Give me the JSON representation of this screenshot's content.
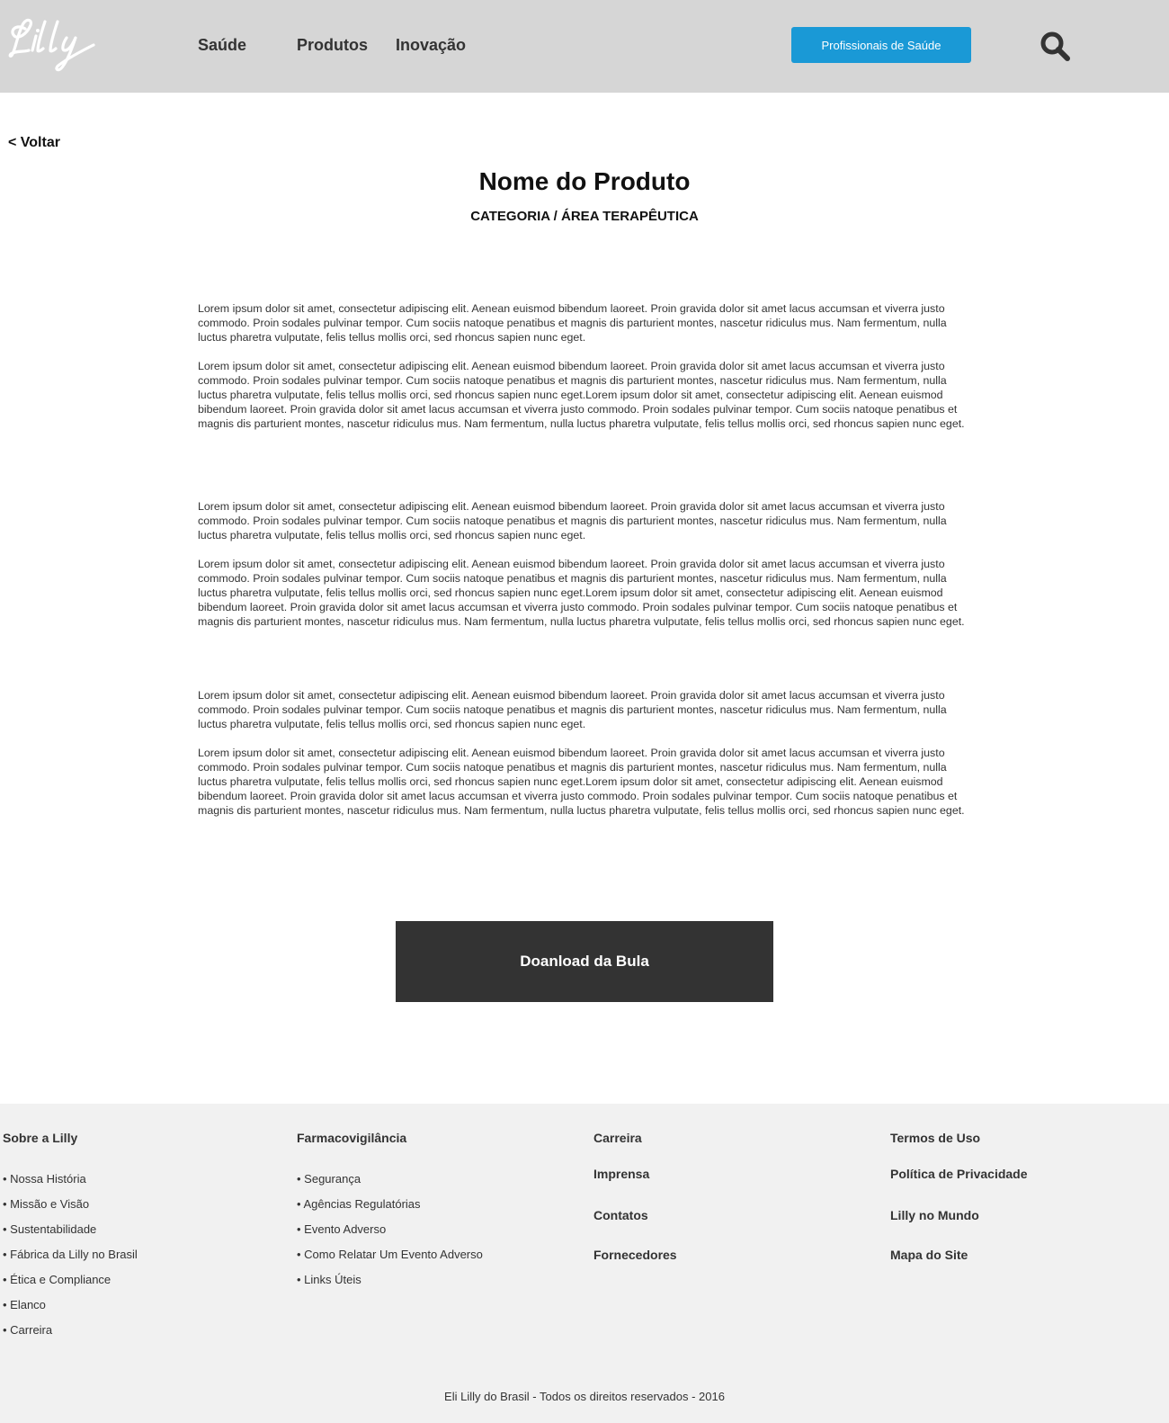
{
  "header": {
    "logo_text": "Lilly",
    "nav": [
      "Saúde",
      "Produtos",
      "Inovação"
    ],
    "cta_label": "Profissionais de Saúde",
    "search_icon": "search-icon"
  },
  "main": {
    "back_label": "< Voltar",
    "title": "Nome do Produto",
    "category": "CATEGORIA / ÁREA TERAPÊUTICA",
    "blocks": [
      {
        "p1": "Lorem ipsum dolor sit amet, consectetur adipiscing elit. Aenean euismod bibendum laoreet. Proin gravida dolor sit amet lacus accumsan et viverra justo commodo. Proin sodales pulvinar tempor. Cum sociis natoque penatibus et magnis dis parturient montes, nascetur ridiculus mus. Nam fermentum, nulla luctus pharetra vulputate, felis tellus mollis orci, sed rhoncus sapien nunc eget.",
        "p2": "Lorem ipsum dolor sit amet, consectetur adipiscing elit. Aenean euismod bibendum laoreet. Proin gravida dolor sit amet lacus accumsan et viverra justo commodo. Proin sodales pulvinar tempor. Cum sociis natoque penatibus et magnis dis parturient montes, nascetur ridiculus mus. Nam fermentum, nulla luctus pharetra vulputate, felis tellus mollis orci, sed rhoncus sapien nunc eget.Lorem ipsum dolor sit amet, consectetur adipiscing elit. Aenean euismod bibendum laoreet. Proin gravida dolor sit amet lacus accumsan et viverra justo commodo. Proin sodales pulvinar tempor. Cum sociis natoque penatibus et magnis dis parturient montes, nascetur ridiculus mus. Nam fermentum, nulla luctus pharetra vulputate, felis tellus mollis orci, sed rhoncus sapien nunc eget."
      },
      {
        "p1": "Lorem ipsum dolor sit amet, consectetur adipiscing elit. Aenean euismod bibendum laoreet. Proin gravida dolor sit amet lacus accumsan et viverra justo commodo. Proin sodales pulvinar tempor. Cum sociis natoque penatibus et magnis dis parturient montes, nascetur ridiculus mus. Nam fermentum, nulla luctus pharetra vulputate, felis tellus mollis orci, sed rhoncus sapien nunc eget.",
        "p2": "Lorem ipsum dolor sit amet, consectetur adipiscing elit. Aenean euismod bibendum laoreet. Proin gravida dolor sit amet lacus accumsan et viverra justo commodo. Proin sodales pulvinar tempor. Cum sociis natoque penatibus et magnis dis parturient montes, nascetur ridiculus mus. Nam fermentum, nulla luctus pharetra vulputate, felis tellus mollis orci, sed rhoncus sapien nunc eget.Lorem ipsum dolor sit amet, consectetur adipiscing elit. Aenean euismod bibendum laoreet. Proin gravida dolor sit amet lacus accumsan et viverra justo commodo. Proin sodales pulvinar tempor. Cum sociis natoque penatibus et magnis dis parturient montes, nascetur ridiculus mus. Nam fermentum, nulla luctus pharetra vulputate, felis tellus mollis orci, sed rhoncus sapien nunc eget."
      },
      {
        "p1": "Lorem ipsum dolor sit amet, consectetur adipiscing elit. Aenean euismod bibendum laoreet. Proin gravida dolor sit amet lacus accumsan et viverra justo commodo. Proin sodales pulvinar tempor. Cum sociis natoque penatibus et magnis dis parturient montes, nascetur ridiculus mus. Nam fermentum, nulla luctus pharetra vulputate, felis tellus mollis orci, sed rhoncus sapien nunc eget.",
        "p2": "Lorem ipsum dolor sit amet, consectetur adipiscing elit. Aenean euismod bibendum laoreet. Proin gravida dolor sit amet lacus accumsan et viverra justo commodo. Proin sodales pulvinar tempor. Cum sociis natoque penatibus et magnis dis parturient montes, nascetur ridiculus mus. Nam fermentum, nulla luctus pharetra vulputate, felis tellus mollis orci, sed rhoncus sapien nunc eget.Lorem ipsum dolor sit amet, consectetur adipiscing elit. Aenean euismod bibendum laoreet. Proin gravida dolor sit amet lacus accumsan et viverra justo commodo. Proin sodales pulvinar tempor. Cum sociis natoque penatibus et magnis dis parturient montes, nascetur ridiculus mus. Nam fermentum, nulla luctus pharetra vulputate, felis tellus mollis orci, sed rhoncus sapien nunc eget."
      }
    ],
    "download_label": "Doanload da Bula"
  },
  "footer": {
    "col1": {
      "heading": "Sobre a Lilly",
      "items": [
        "• Nossa História",
        "• Missão e Visão",
        "• Sustentabilidade",
        "• Fábrica da Lilly no Brasil",
        "• Ética e Compliance",
        "• Elanco",
        "• Carreira"
      ]
    },
    "col2": {
      "heading": "Farmacovigilância",
      "items": [
        "• Segurança",
        "• Agências Regulatórias",
        "• Evento Adverso",
        "• Como Relatar Um Evento Adverso",
        "• Links Úteis"
      ]
    },
    "col3": {
      "links": [
        "Carreira",
        "Imprensa",
        "Contatos",
        "Fornecedores"
      ]
    },
    "col4": {
      "links": [
        "Termos de Uso",
        "Política de Privacidade",
        "Lilly no Mundo",
        "Mapa do Site"
      ]
    },
    "copyright": "Eli Lilly do Brasil - Todos os direitos reservados - 2016"
  },
  "colors": {
    "header_bg": "#d6d6d6",
    "accent": "#1a99d6",
    "download_bg": "#333333",
    "footer_bg": "#f1f1f1"
  }
}
